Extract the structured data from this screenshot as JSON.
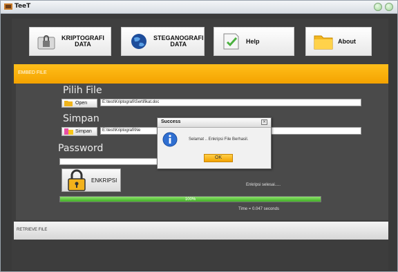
{
  "window": {
    "title": "TeeT"
  },
  "toolbar": {
    "kriptografi": "KRIPTOGRAFI\nDATA",
    "steganografi": "STEGANOGRAFI\nDATA",
    "help": "Help",
    "about": "About"
  },
  "embed": {
    "header": "EMBED FILE",
    "pilih_file_label": "Pilih File",
    "open_button": "Open",
    "file_path": "E:\\test\\Kriptografi\\Sertifikat.doc",
    "simpan_label": "Simpan",
    "simpan_button": "Simpan",
    "simpan_path": "E:\\test\\Kriptografi\\Ne",
    "password_label": "Password",
    "password_value": "",
    "enkripsi_button": "ENKRIPSI",
    "status_text": "Enkripsi selesai.....",
    "progress_value": 100,
    "progress_text": "100%",
    "time_text": "Time =  0.047 seconds"
  },
  "retrieve": {
    "header": "RETRIEVE FILE"
  },
  "dialog": {
    "title": "Success",
    "message": "Selamat .. Enkripsi File Berhasil.",
    "ok_button": "OK",
    "close_glyph": "×"
  },
  "icons": {
    "kriptografi": "lock-folder-icon",
    "steganografi": "globe-icon",
    "help": "document-check-icon",
    "about": "folder-icon",
    "open": "open-folder-icon",
    "simpan": "save-icon",
    "enkripsi": "padlock-icon",
    "dialog": "info-icon"
  },
  "colors": {
    "accent": "#f4a300",
    "progress": "#4cbf2e"
  }
}
